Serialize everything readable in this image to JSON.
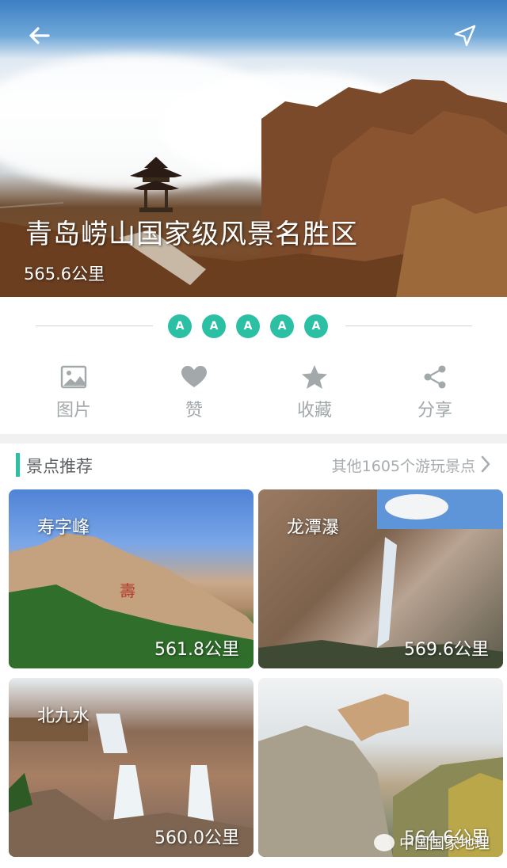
{
  "hero": {
    "title": "青岛崂山国家级风景名胜区",
    "distance": "565.6公里",
    "back_icon": "arrow-left-icon",
    "locate_icon": "navigation-arrow-icon"
  },
  "rating": {
    "badges": [
      "A",
      "A",
      "A",
      "A",
      "A"
    ],
    "color": "#2bc0a4"
  },
  "actions": [
    {
      "label": "图片",
      "icon": "image-icon"
    },
    {
      "label": "赞",
      "icon": "heart-icon"
    },
    {
      "label": "收藏",
      "icon": "star-icon"
    },
    {
      "label": "分享",
      "icon": "share-icon"
    }
  ],
  "section": {
    "title": "景点推荐",
    "more": "其他1605个游玩景点",
    "accent": "#2bc0a4"
  },
  "spots": [
    {
      "name": "寿字峰",
      "distance": "561.8公里"
    },
    {
      "name": "龙潭瀑",
      "distance": "569.6公里"
    },
    {
      "name": "北九水",
      "distance": "560.0公里"
    },
    {
      "name": "",
      "distance": "564.6公里"
    }
  ],
  "watermark": "中国国家地理"
}
